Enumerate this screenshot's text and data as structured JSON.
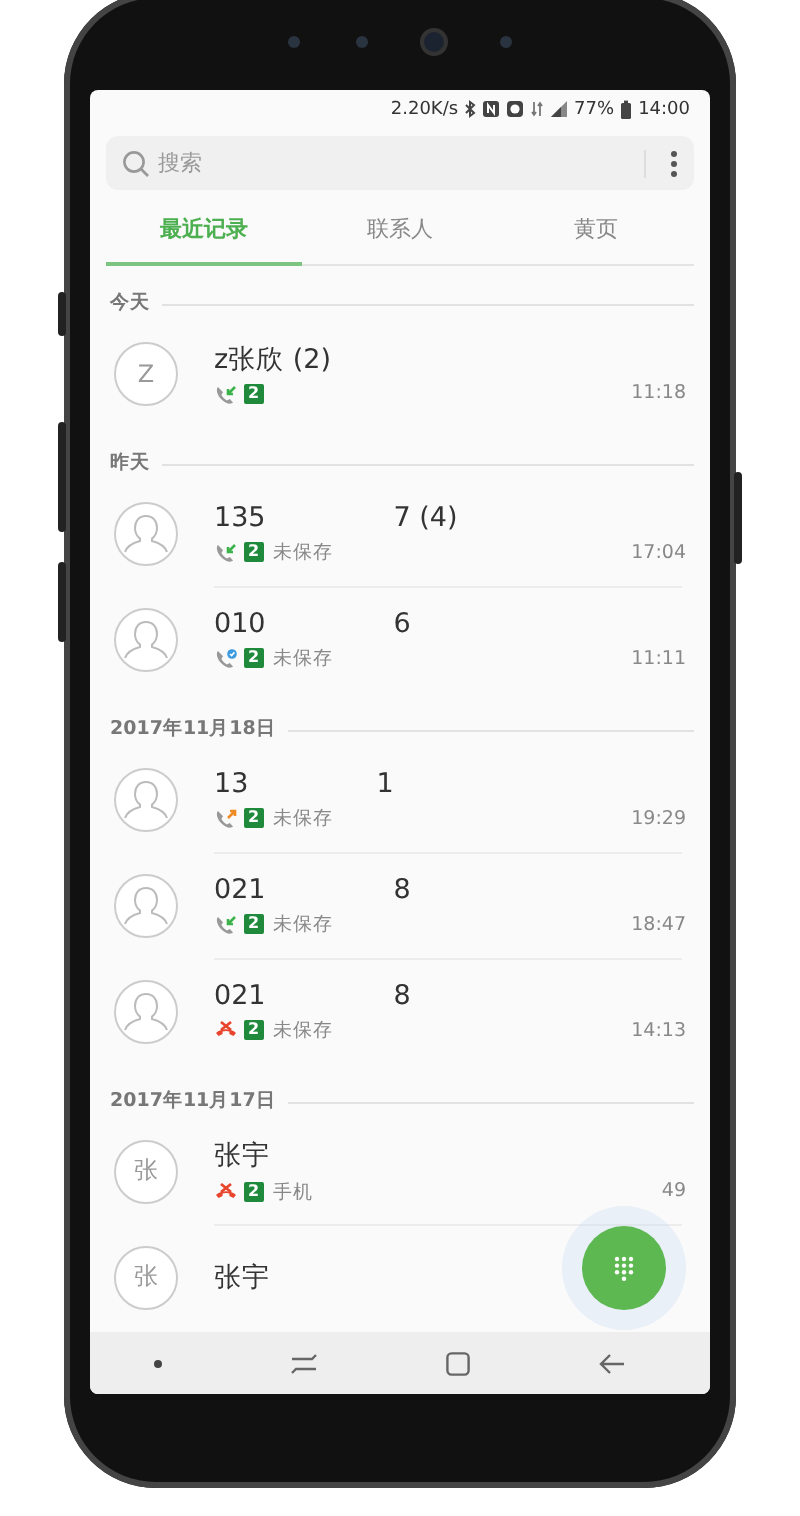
{
  "status_bar": {
    "speed": "2.20K/s",
    "battery": "77%",
    "time": "14:00"
  },
  "search": {
    "placeholder": "搜索"
  },
  "tabs": [
    {
      "label": "最近记录",
      "selected": true
    },
    {
      "label": "联系人",
      "selected": false
    },
    {
      "label": "黄页",
      "selected": false
    }
  ],
  "sections": [
    {
      "title": "今天",
      "calls": [
        {
          "avatar": {
            "kind": "letter",
            "text": "Z"
          },
          "name": "z张欣 (2)",
          "kind": "incoming",
          "sim": "2",
          "time": "11:18"
        }
      ]
    },
    {
      "title": "昨天",
      "calls": [
        {
          "avatar": {
            "kind": "silhouette"
          },
          "name": "135",
          "name_end": "7 (4)",
          "kind": "incoming",
          "sim": "2",
          "label": "未保存",
          "time": "17:04"
        },
        {
          "avatar": {
            "kind": "silhouette"
          },
          "name": "010",
          "name_end": "6",
          "kind": "wifi",
          "sim": "2",
          "label": "未保存",
          "time": "11:11"
        }
      ]
    },
    {
      "title": "2017年11月18日",
      "calls": [
        {
          "avatar": {
            "kind": "silhouette"
          },
          "name": "13",
          "name_end": "1",
          "kind": "outgoing",
          "sim": "2",
          "label": "未保存",
          "time": "19:29"
        },
        {
          "avatar": {
            "kind": "silhouette"
          },
          "name": "021",
          "name_end": "8",
          "kind": "incoming",
          "sim": "2",
          "label": "未保存",
          "time": "18:47"
        },
        {
          "avatar": {
            "kind": "silhouette"
          },
          "name": "021",
          "name_end": "8",
          "kind": "rejected",
          "sim": "2",
          "label": "未保存",
          "time": "14:13"
        }
      ]
    },
    {
      "title": "2017年11月17日",
      "calls": [
        {
          "avatar": {
            "kind": "letter",
            "text": "张"
          },
          "name": "张宇",
          "kind": "rejected",
          "sim": "2",
          "label": "手机",
          "time": "49"
        },
        {
          "avatar": {
            "kind": "letter",
            "text": "张"
          },
          "name": "张宇"
        }
      ]
    }
  ]
}
